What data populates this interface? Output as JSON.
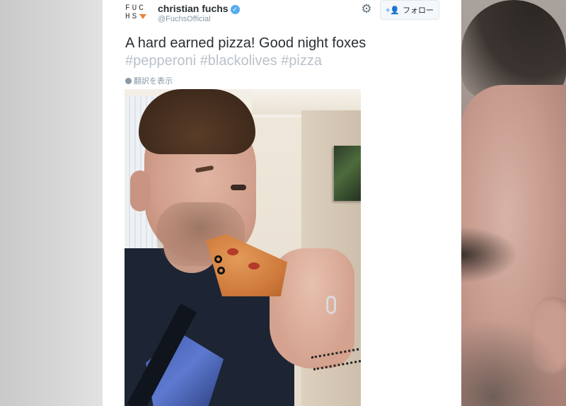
{
  "tweet": {
    "logo_line1": "FUC",
    "logo_line2": "HS",
    "author_name": "christian fuchs",
    "author_handle": "@FuchsOfficial",
    "follow_label": "フォロー",
    "follow_icon": "add-user-icon",
    "settings_icon": "gear-icon",
    "verified_icon": "verified-badge-icon",
    "text_main": "A hard earned pizza! Good night foxes",
    "hashtags": [
      "#pepperoni",
      "#blackolives",
      "#pizza"
    ],
    "translate_label": "翻訳を表示",
    "translate_icon": "globe-icon",
    "photo_alt": "Man winking while eating a slice of pizza"
  },
  "colors": {
    "text": "#292f33",
    "muted": "#8899a6",
    "hashtag": "#b9c2ca",
    "verified": "#55acee",
    "logo_accent": "#e8833a"
  }
}
